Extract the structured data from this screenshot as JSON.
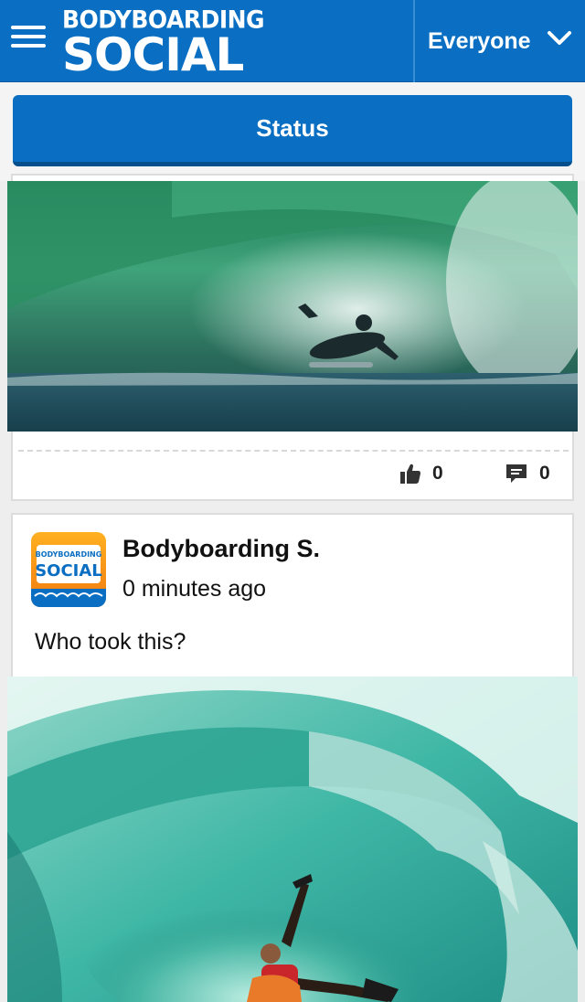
{
  "header": {
    "logo_top": "BODYBOARDING",
    "logo_bottom": "SOCIAL",
    "audience": "Everyone",
    "accent": "#0a6fc2"
  },
  "status_button": {
    "label": "Status"
  },
  "posts": [
    {
      "image_icon": "wave-photo",
      "likes": "0",
      "comments": "0"
    },
    {
      "avatar_top": "BODYBOARDING",
      "avatar_bottom": "SOCIAL",
      "author": "Bodyboarding S.",
      "time": "0 minutes ago",
      "text": "Who took this?",
      "image_icon": "barrel-photo"
    }
  ],
  "icons": {
    "menu": "hamburger-icon",
    "audience": "chevron-down-icon",
    "like": "thumbs-up-icon",
    "comment": "comment-icon"
  }
}
